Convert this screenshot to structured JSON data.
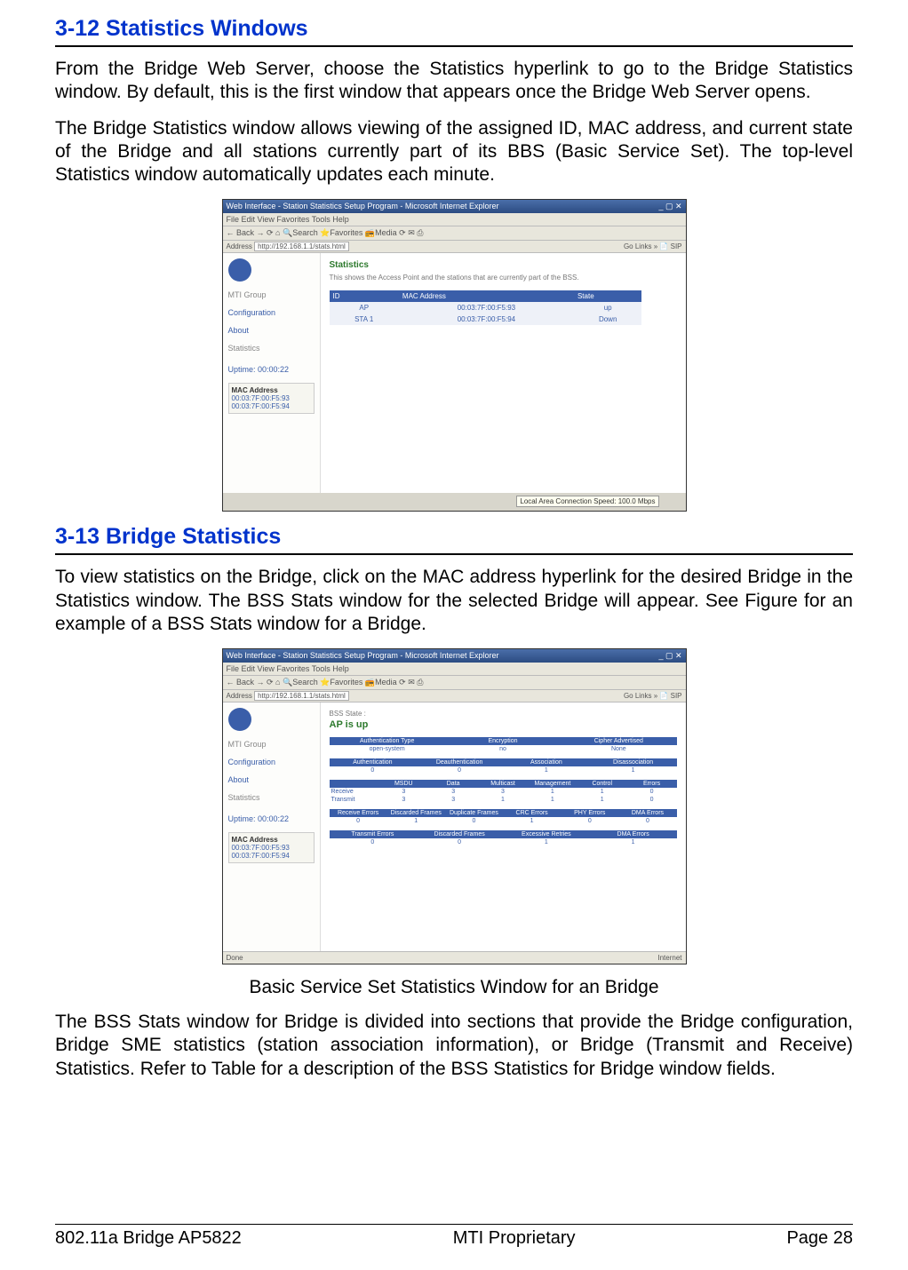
{
  "headings": {
    "h1": "3-12 Statistics Windows",
    "h2": "3-13 Bridge Statistics"
  },
  "paragraphs": {
    "p1": "From the Bridge Web Server, choose the Statistics hyperlink to go to the Bridge Statistics window. By default, this is the first window that appears once the Bridge Web Server opens.",
    "p2": "The Bridge Statistics window allows viewing of the assigned ID, MAC address, and current state of the Bridge and all stations currently part of its BBS (Basic Service Set). The top-level Statistics window automatically updates each minute.",
    "p3": "To view statistics on the Bridge, click on the MAC address hyperlink for the desired Bridge in the Statistics window. The BSS Stats window for the selected Bridge will appear. See Figure for an example of a BSS Stats window for a Bridge.",
    "caption2": "Basic Service Set Statistics Window for an Bridge",
    "p4": "The BSS Stats window for Bridge is divided into sections that provide the Bridge configuration, Bridge SME statistics (station association information), or Bridge (Transmit and Receive) Statistics. Refer to Table for a description of the BSS Statistics for Bridge window fields."
  },
  "screenshot1": {
    "title": "Web Interface - Station Statistics Setup Program - Microsoft Internet Explorer",
    "menu": "File  Edit  View  Favorites  Tools  Help",
    "toolbar": "← Back  →  ⟳  ⌂  🔍Search  ⭐Favorites  📻Media  ⟳ ✉ ⎙",
    "addr_label": "Address",
    "addr": "http://192.168.1.1/stats.html",
    "go": "Go   Links »  📄 SIP",
    "side": {
      "brand": "MTI Group",
      "links": [
        "Configuration",
        "About",
        "Statistics"
      ],
      "uptime_label": "Uptime: 00:00:22",
      "mac_label": "MAC Address",
      "macs": [
        "00:03:7F:00:F5:93",
        "00:03:7F:00:F5:94"
      ]
    },
    "main": {
      "heading": "Statistics",
      "desc": "This shows the Access Point and the stations that are currently part of the BSS.",
      "thead": [
        "ID",
        "MAC Address",
        "State"
      ],
      "rows": [
        [
          "AP",
          "00:03:7F:00:F5:93",
          "up"
        ],
        [
          "STA 1",
          "00:03:7F:00:F5:94",
          "Down"
        ]
      ]
    },
    "tooltip": "Local Area Connection\nSpeed: 100.0 Mbps"
  },
  "screenshot2": {
    "title": "Web Interface - Station Statistics Setup Program - Microsoft Internet Explorer",
    "menu": "File  Edit  View  Favorites  Tools  Help",
    "toolbar": "← Back  →  ⟳  ⌂  🔍Search  ⭐Favorites  📻Media  ⟳ ✉ ⎙",
    "addr_label": "Address",
    "addr": "http://192.168.1.1/stats.html",
    "go": "Go   Links »  📄 SIP",
    "side": {
      "brand": "MTI Group",
      "links": [
        "Configuration",
        "About",
        "Statistics"
      ],
      "uptime_label": "Uptime: 00:00:22",
      "mac_label": "MAC Address",
      "macs": [
        "00:03:7F:00:F5:93",
        "00:03:7F:00:F5:94"
      ]
    },
    "main": {
      "state_label": "BSS State :",
      "state": "AP is up",
      "t1h": [
        "Authentication Type",
        "Encryption",
        "Cipher Advertised"
      ],
      "t1r": [
        "open-system",
        "no",
        "None"
      ],
      "t2h": [
        "Authentication",
        "Deauthentication",
        "Association",
        "Disassociation"
      ],
      "t2r": [
        "0",
        "0",
        "1",
        "1"
      ],
      "t3h": [
        "",
        "MSDU",
        "Data",
        "Multicast",
        "Management",
        "Control",
        "Errors"
      ],
      "t3r1": [
        "Receive",
        "3",
        "3",
        "3",
        "1",
        "1",
        "0"
      ],
      "t3r2": [
        "Transmit",
        "3",
        "3",
        "1",
        "1",
        "1",
        "0"
      ],
      "t4h": [
        "Receive Errors",
        "Discarded Frames",
        "Duplicate Frames",
        "CRC Errors",
        "PHY Errors",
        "DMA Errors"
      ],
      "t4r": [
        "0",
        "1",
        "0",
        "1",
        "0",
        "0"
      ],
      "t5h": [
        "Transmit Errors",
        "Discarded Frames",
        "Excessive Retries",
        "DMA Errors"
      ],
      "t5r": [
        "0",
        "0",
        "1",
        "1"
      ]
    },
    "status_left": "Done",
    "status_right": "Internet"
  },
  "footer": {
    "left": "802.11a Bridge AP5822",
    "center": "MTI Proprietary",
    "right": "Page 28"
  }
}
